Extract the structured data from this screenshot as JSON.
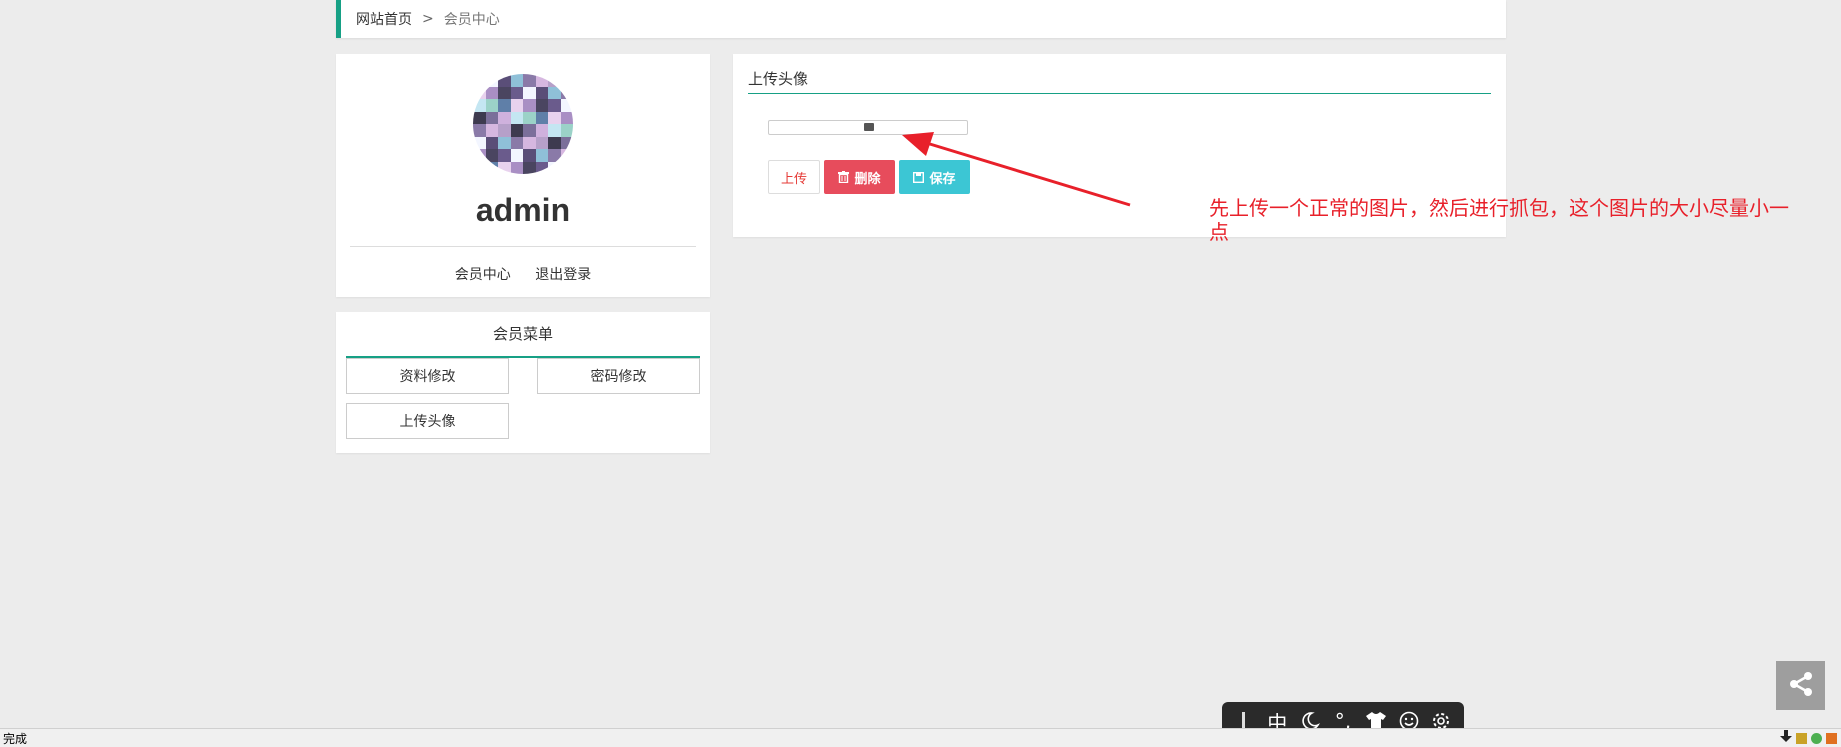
{
  "breadcrumb": {
    "home": "网站首页",
    "separator": ">",
    "current": "会员中心"
  },
  "profile": {
    "username": "admin",
    "link_member_center": "会员中心",
    "link_logout": "退出登录"
  },
  "menu": {
    "title": "会员菜单",
    "items": [
      "资料修改",
      "密码修改",
      "上传头像"
    ]
  },
  "upload_panel": {
    "title": "上传头像",
    "buttons": {
      "upload": "上传",
      "delete": "删除",
      "save": "保存"
    }
  },
  "annotation": {
    "text": "先上传一个正常的图片，然后进行抓包，这个图片的大小尽量小一点",
    "color": "#e8202a"
  },
  "ime_toolbar": {
    "mode": "中",
    "punctuation": "°,"
  },
  "statusbar": {
    "text": "完成"
  },
  "colors": {
    "accent": "#16a085",
    "danger": "#e74c5c",
    "info": "#3cc6d4",
    "background": "#ececec"
  }
}
